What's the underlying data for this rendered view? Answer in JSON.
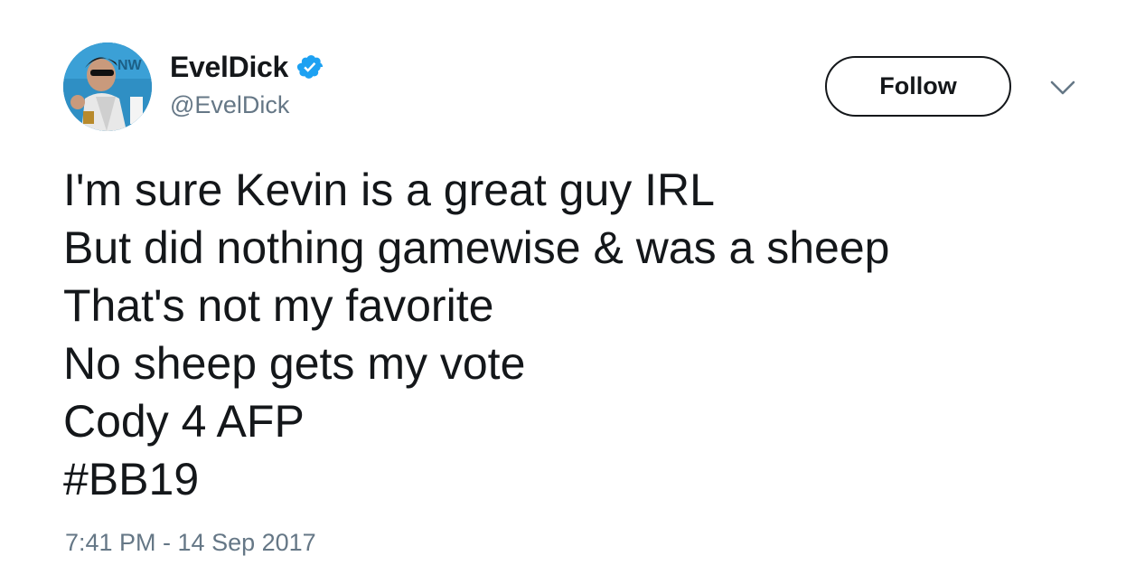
{
  "user": {
    "display_name": "EvelDick",
    "handle": "@EvelDick",
    "verified": true,
    "avatar_icon": "profile-photo"
  },
  "actions": {
    "follow_label": "Follow",
    "menu_icon": "chevron-down-icon"
  },
  "tweet": {
    "lines": [
      "I'm sure Kevin is a great guy IRL",
      "But did nothing gamewise & was a sheep",
      "That's not my favorite",
      "No sheep gets my vote",
      "Cody 4 AFP"
    ],
    "hashtag": "#BB19",
    "timestamp": "7:41 PM - 14 Sep 2017"
  },
  "colors": {
    "verified_badge": "#1da1f2",
    "text_primary": "#14171a",
    "text_secondary": "#657786"
  }
}
